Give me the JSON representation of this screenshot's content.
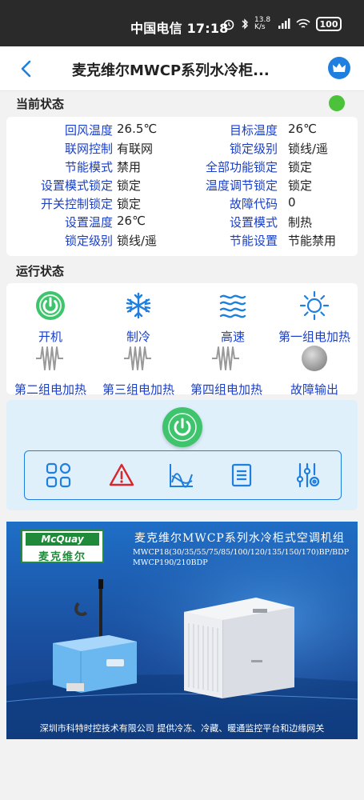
{
  "status_bar": {
    "text": "中国电信 17:18",
    "net_speed": "13.8 K/s",
    "battery": "100"
  },
  "header": {
    "title": "麦克维尔MWCP系列水冷柜..."
  },
  "current_status": {
    "title": "当前状态",
    "rows": [
      {
        "l1": "回风温度",
        "v1": "26.5℃",
        "l2": "目标温度",
        "v2": "26℃"
      },
      {
        "l1": "联网控制",
        "v1": "有联网",
        "l2": "锁定级别",
        "v2": "锁线/遥"
      },
      {
        "l1": "节能模式",
        "v1": "禁用",
        "l2": "全部功能锁定",
        "v2": "锁定"
      },
      {
        "l1": "设置模式锁定",
        "v1": "锁定",
        "l2": "温度调节锁定",
        "v2": "锁定"
      },
      {
        "l1": "开关控制锁定",
        "v1": "锁定",
        "l2": "故障代码",
        "v2": "0"
      },
      {
        "l1": "设置温度",
        "v1": "26℃",
        "l2": "设置模式",
        "v2": "制热"
      },
      {
        "l1": "锁定级别",
        "v1": "锁线/遥",
        "l2": "节能设置",
        "v2": "节能禁用"
      }
    ]
  },
  "run_status": {
    "title": "运行状态",
    "items": [
      {
        "label": "开机",
        "icon": "power-on-icon"
      },
      {
        "label": "制冷",
        "icon": "snowflake-icon"
      },
      {
        "label": "高速",
        "icon": "wind-waves-icon"
      },
      {
        "label": "第一组电加热",
        "icon": "sun-icon"
      },
      {
        "label": "第二组电加热",
        "icon": "heater-coil-icon"
      },
      {
        "label": "第三组电加热",
        "icon": "heater-coil-icon"
      },
      {
        "label": "第四组电加热",
        "icon": "heater-coil-icon"
      },
      {
        "label": "故障输出",
        "icon": "fault-indicator-icon"
      }
    ]
  },
  "toolbar": {
    "tools": [
      "grid-icon",
      "warning-icon",
      "chart-icon",
      "list-icon",
      "settings-sliders-icon"
    ]
  },
  "banner": {
    "logo_en": "McQuay",
    "logo_cn": "麦克维尔",
    "heading": "麦克维尔MWCP系列水冷柜式空调机组",
    "models_line1": "MWCP18(30/35/55/75/85/100/120/135/150/170)BP/BDP",
    "models_line2": "MWCP190/210BDP",
    "footer": "深圳市科特时控技术有限公司    提供冷冻、冷藏、暖通监控平台和边缘网关"
  },
  "colors": {
    "label_blue": "#1a3fc8",
    "accent_blue": "#1e7fe0",
    "status_green": "#4cc23a",
    "power_green": "#3ec46d"
  }
}
